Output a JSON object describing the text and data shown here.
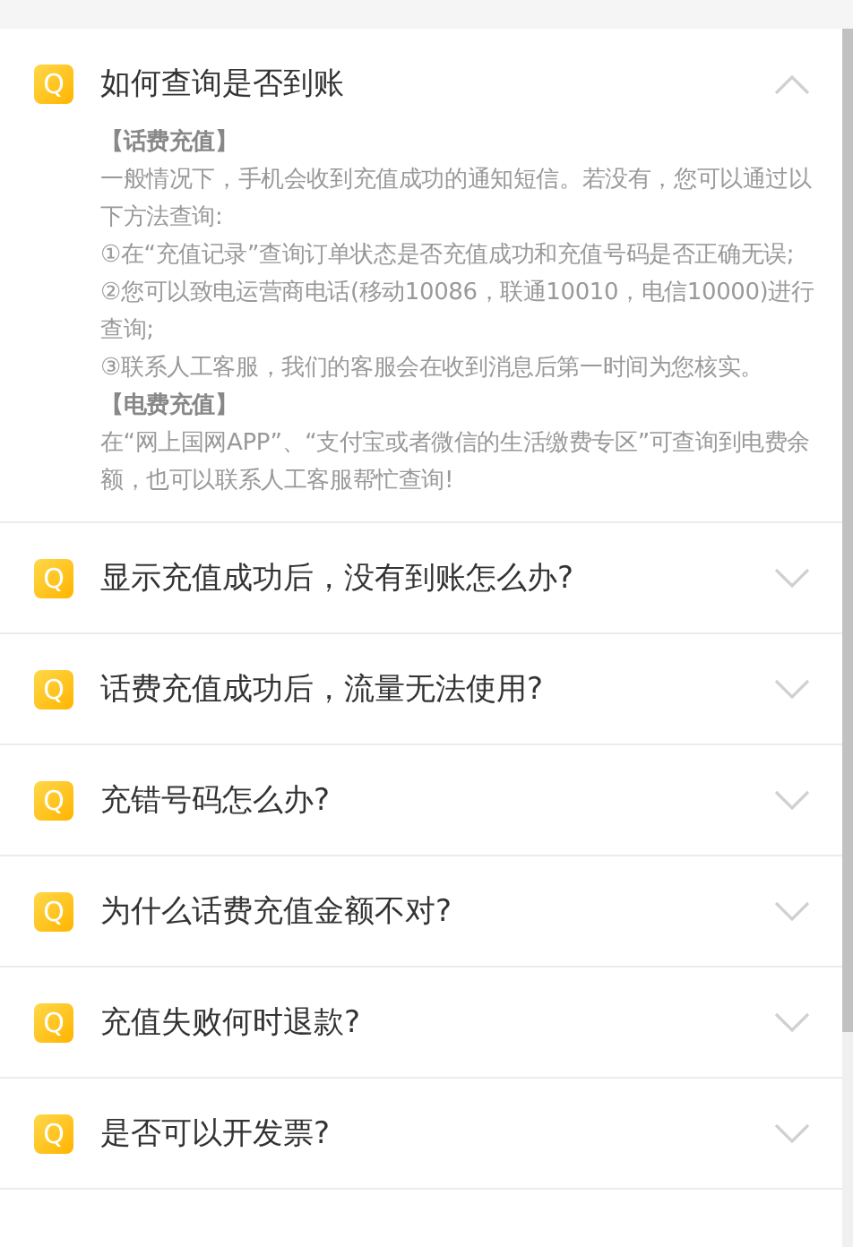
{
  "faqs": [
    {
      "badge": "Q",
      "question": "如何查询是否到账",
      "expanded": true,
      "answer": [
        {
          "kind": "heading",
          "text": "【话费充值】"
        },
        {
          "kind": "text",
          "text": "一般情况下，手机会收到充值成功的通知短信。若没有，您可以通过以下方法查询:"
        },
        {
          "kind": "text",
          "text": "①在“充值记录”查询订单状态是否充值成功和充值号码是否正确无误;"
        },
        {
          "kind": "text",
          "text": "②您可以致电运营商电话(移动10086，联通10010，电信10000)进行查询;"
        },
        {
          "kind": "text",
          "text": "③联系人工客服，我们的客服会在收到消息后第一时间为您核实。"
        },
        {
          "kind": "heading",
          "text": "【电费充值】"
        },
        {
          "kind": "text",
          "text": "在“网上国网APP”、“支付宝或者微信的生活缴费专区”可查询到电费余额，也可以联系人工客服帮忙查询!"
        }
      ]
    },
    {
      "badge": "Q",
      "question": "显示充值成功后，没有到账怎么办?",
      "expanded": false
    },
    {
      "badge": "Q",
      "question": "话费充值成功后，流量无法使用?",
      "expanded": false
    },
    {
      "badge": "Q",
      "question": "充错号码怎么办?",
      "expanded": false
    },
    {
      "badge": "Q",
      "question": "为什么话费充值金额不对?",
      "expanded": false
    },
    {
      "badge": "Q",
      "question": "充值失败何时退款?",
      "expanded": false
    },
    {
      "badge": "Q",
      "question": "是否可以开发票?",
      "expanded": false
    }
  ]
}
